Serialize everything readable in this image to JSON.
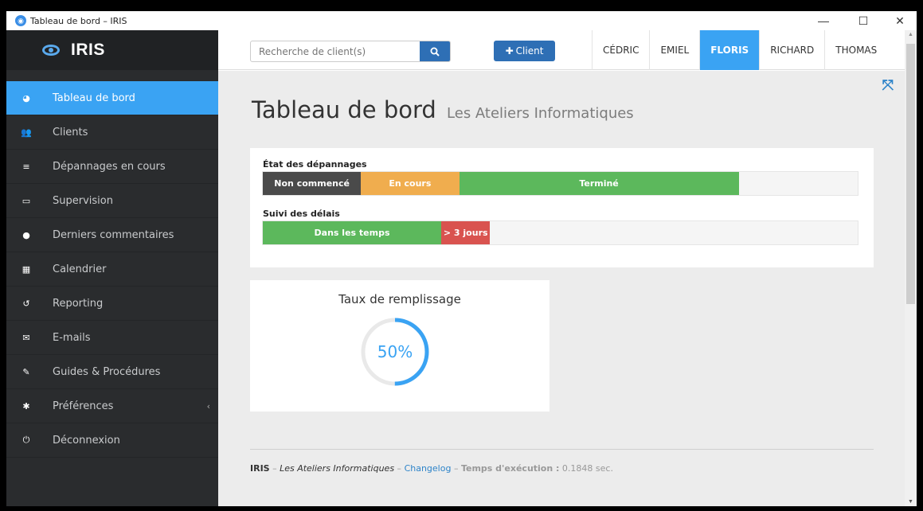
{
  "window": {
    "title": "Tableau de bord – IRIS",
    "minimize": "—",
    "maximize": "☐",
    "close": "✕"
  },
  "brand": {
    "name": "IRIS"
  },
  "sidebar": {
    "items": [
      {
        "label": "Tableau de bord",
        "icon": "dashboard-icon",
        "glyph": "◕",
        "active": true
      },
      {
        "label": "Clients",
        "icon": "users-icon",
        "glyph": "👥"
      },
      {
        "label": "Dépannages en cours",
        "icon": "tasks-icon",
        "glyph": "≡"
      },
      {
        "label": "Supervision",
        "icon": "desktop-icon",
        "glyph": "▭"
      },
      {
        "label": "Derniers commentaires",
        "icon": "comments-icon",
        "glyph": "●"
      },
      {
        "label": "Calendrier",
        "icon": "calendar-icon",
        "glyph": "▦"
      },
      {
        "label": "Reporting",
        "icon": "history-icon",
        "glyph": "↺"
      },
      {
        "label": "E-mails",
        "icon": "envelope-icon",
        "glyph": "✉"
      },
      {
        "label": "Guides & Procédures",
        "icon": "edit-icon",
        "glyph": "✎"
      },
      {
        "label": "Préférences",
        "icon": "gear-icon",
        "glyph": "✱",
        "chevron": "‹"
      },
      {
        "label": "Déconnexion",
        "icon": "power-icon",
        "glyph": "⏻"
      }
    ]
  },
  "header": {
    "search_placeholder": "Recherche de client(s)",
    "add_client_label": "Client",
    "users": [
      {
        "name": "CÉDRIC"
      },
      {
        "name": "EMIEL"
      },
      {
        "name": "FLORIS",
        "active": true
      },
      {
        "name": "RICHARD"
      },
      {
        "name": "THOMAS"
      }
    ]
  },
  "main": {
    "title": "Tableau de bord",
    "subtitle": "Les Ateliers Informatiques",
    "repairs": {
      "label": "État des dépannages",
      "segments": [
        {
          "label": "Non commencé",
          "percent": 16.5,
          "color": "#4a4a4a"
        },
        {
          "label": "En cours",
          "percent": 16.5,
          "color": "#f0ad4e"
        },
        {
          "label": "Terminé",
          "percent": 47,
          "color": "#5cb85c"
        }
      ]
    },
    "deadlines": {
      "label": "Suivi des délais",
      "segments": [
        {
          "label": "Dans les temps",
          "percent": 30,
          "color": "#5cb85c"
        },
        {
          "label": "> 3 jours",
          "percent": 8.2,
          "color": "#d9534f"
        }
      ]
    },
    "fill_rate": {
      "title": "Taux de remplissage",
      "value": 50,
      "display": "50%",
      "color": "#3aa3f3"
    }
  },
  "footer": {
    "app": "IRIS",
    "sep1": " – ",
    "company": "Les Ateliers Informatiques",
    "sep2": " – ",
    "changelog": "Changelog",
    "sep3": " – ",
    "exec_label": "Temps d'exécution :",
    "exec_value": " 0.1848 sec."
  }
}
